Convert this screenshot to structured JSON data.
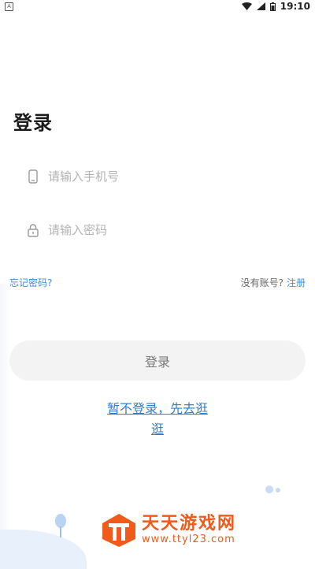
{
  "status_bar": {
    "notification_icon": "a-notification-icon",
    "time": "19:10",
    "icons": [
      "wifi-icon",
      "signal-icon",
      "battery-icon"
    ]
  },
  "page": {
    "title": "登录"
  },
  "phone": {
    "placeholder": "请输入手机号",
    "icon": "phone-icon"
  },
  "password": {
    "placeholder": "请输入密码",
    "icon": "lock-icon"
  },
  "links": {
    "forgot": "忘记密码?",
    "no_account": "没有账号?",
    "register": "注册"
  },
  "login_button": "登录",
  "browse_link_line1": "暂不登录，先去逛",
  "browse_link_line2": "逛",
  "watermark": {
    "logo_letters": "TT",
    "name": "天天游戏网",
    "url": "www.ttyl23.com"
  },
  "colors": {
    "link": "#3a8ee6",
    "watermark": "#f05a1a",
    "button_bg": "#f3f3f3"
  }
}
